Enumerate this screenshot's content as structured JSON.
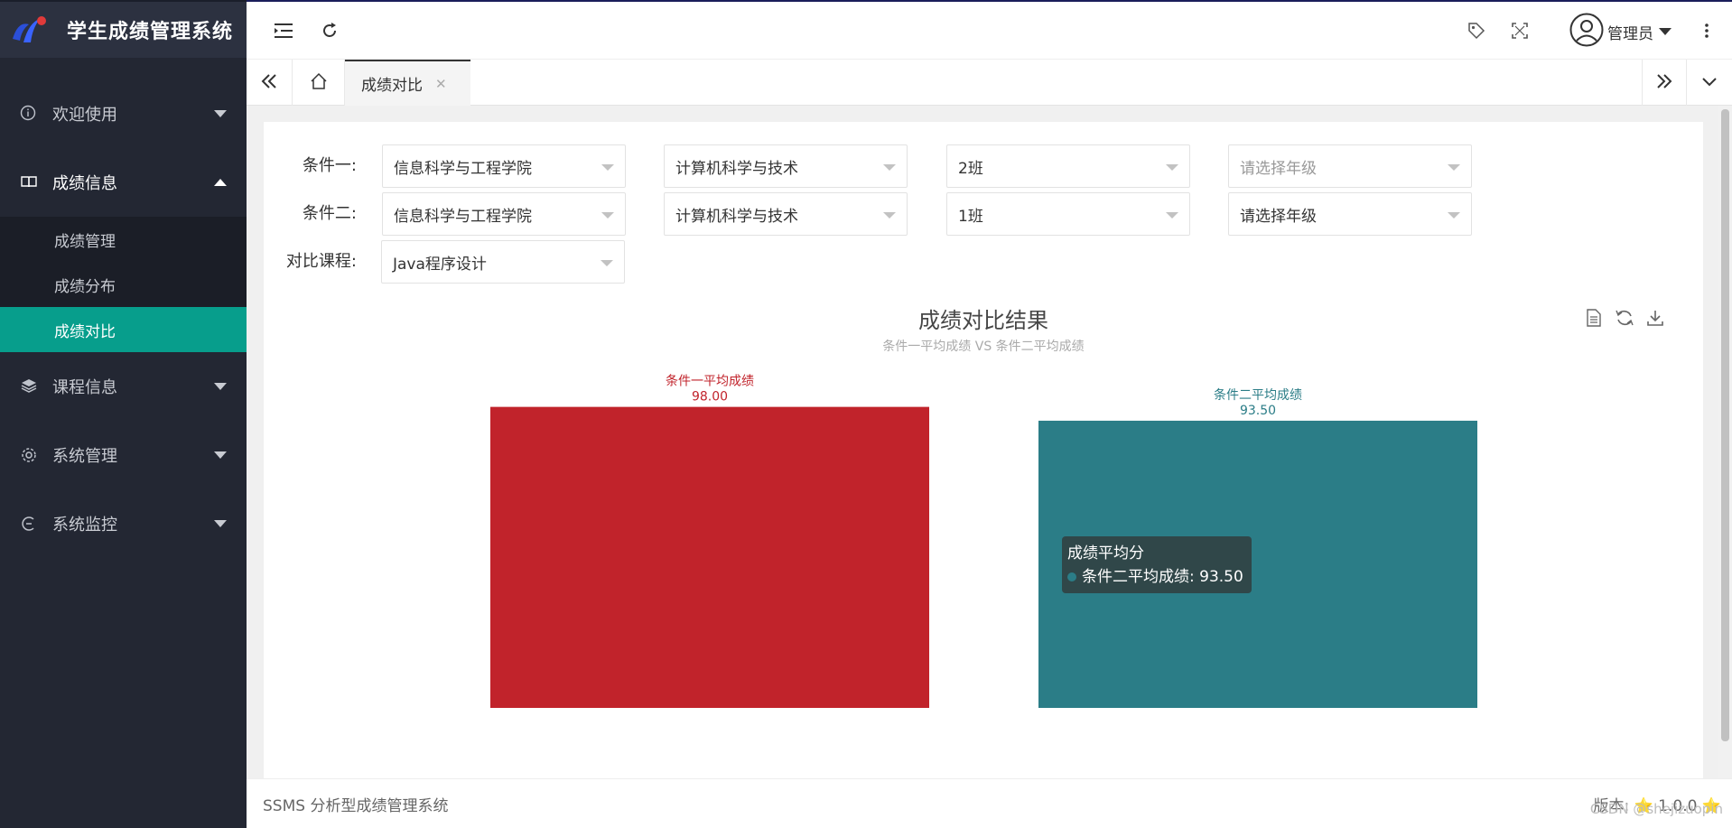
{
  "app": {
    "title": "学生成绩管理系统"
  },
  "sidebar": {
    "items": [
      {
        "label": "欢迎使用",
        "icon": "info-circle-icon",
        "expanded": false
      },
      {
        "label": "成绩信息",
        "icon": "book-icon",
        "expanded": true,
        "children": [
          {
            "label": "成绩管理",
            "active": false
          },
          {
            "label": "成绩分布",
            "active": false
          },
          {
            "label": "成绩对比",
            "active": true
          }
        ]
      },
      {
        "label": "课程信息",
        "icon": "layers-icon",
        "expanded": false
      },
      {
        "label": "系统管理",
        "icon": "gear-icon",
        "expanded": false
      },
      {
        "label": "系统监控",
        "icon": "monitor-icon",
        "expanded": false
      }
    ]
  },
  "topbar": {
    "user_label": "管理员"
  },
  "tabs": [
    {
      "label": "成绩对比",
      "closable": true
    }
  ],
  "filters": {
    "cond1": {
      "label": "条件一:",
      "college": "信息科学与工程学院",
      "major": "计算机科学与技术",
      "class": "2班",
      "grade_placeholder": "请选择年级"
    },
    "cond2": {
      "label": "条件二:",
      "college": "信息科学与工程学院",
      "major": "计算机科学与技术",
      "class": "1班",
      "grade": "请选择年级"
    },
    "course": {
      "label": "对比课程:",
      "value": "Java程序设计"
    }
  },
  "chart_data": {
    "type": "bar",
    "title": "成绩对比结果",
    "subtitle": "条件一平均成绩 VS 条件二平均成绩",
    "categories": [
      "条件一平均成绩",
      "条件二平均成绩"
    ],
    "values": [
      98.0,
      93.5
    ],
    "value_labels": [
      "98.00",
      "93.50"
    ],
    "colors": [
      "#c1232b",
      "#2b7d87"
    ],
    "ylim": [
      0,
      107
    ],
    "grid": false,
    "tooltip": {
      "title": "成绩平均分",
      "series": "条件二平均成绩",
      "value": "93.50"
    }
  },
  "footer": {
    "left": "SSMS 分析型成绩管理系统",
    "right": "版本: ⭐ 1.0.0 ⭐",
    "watermark": "CSDN @shejizuopin"
  }
}
